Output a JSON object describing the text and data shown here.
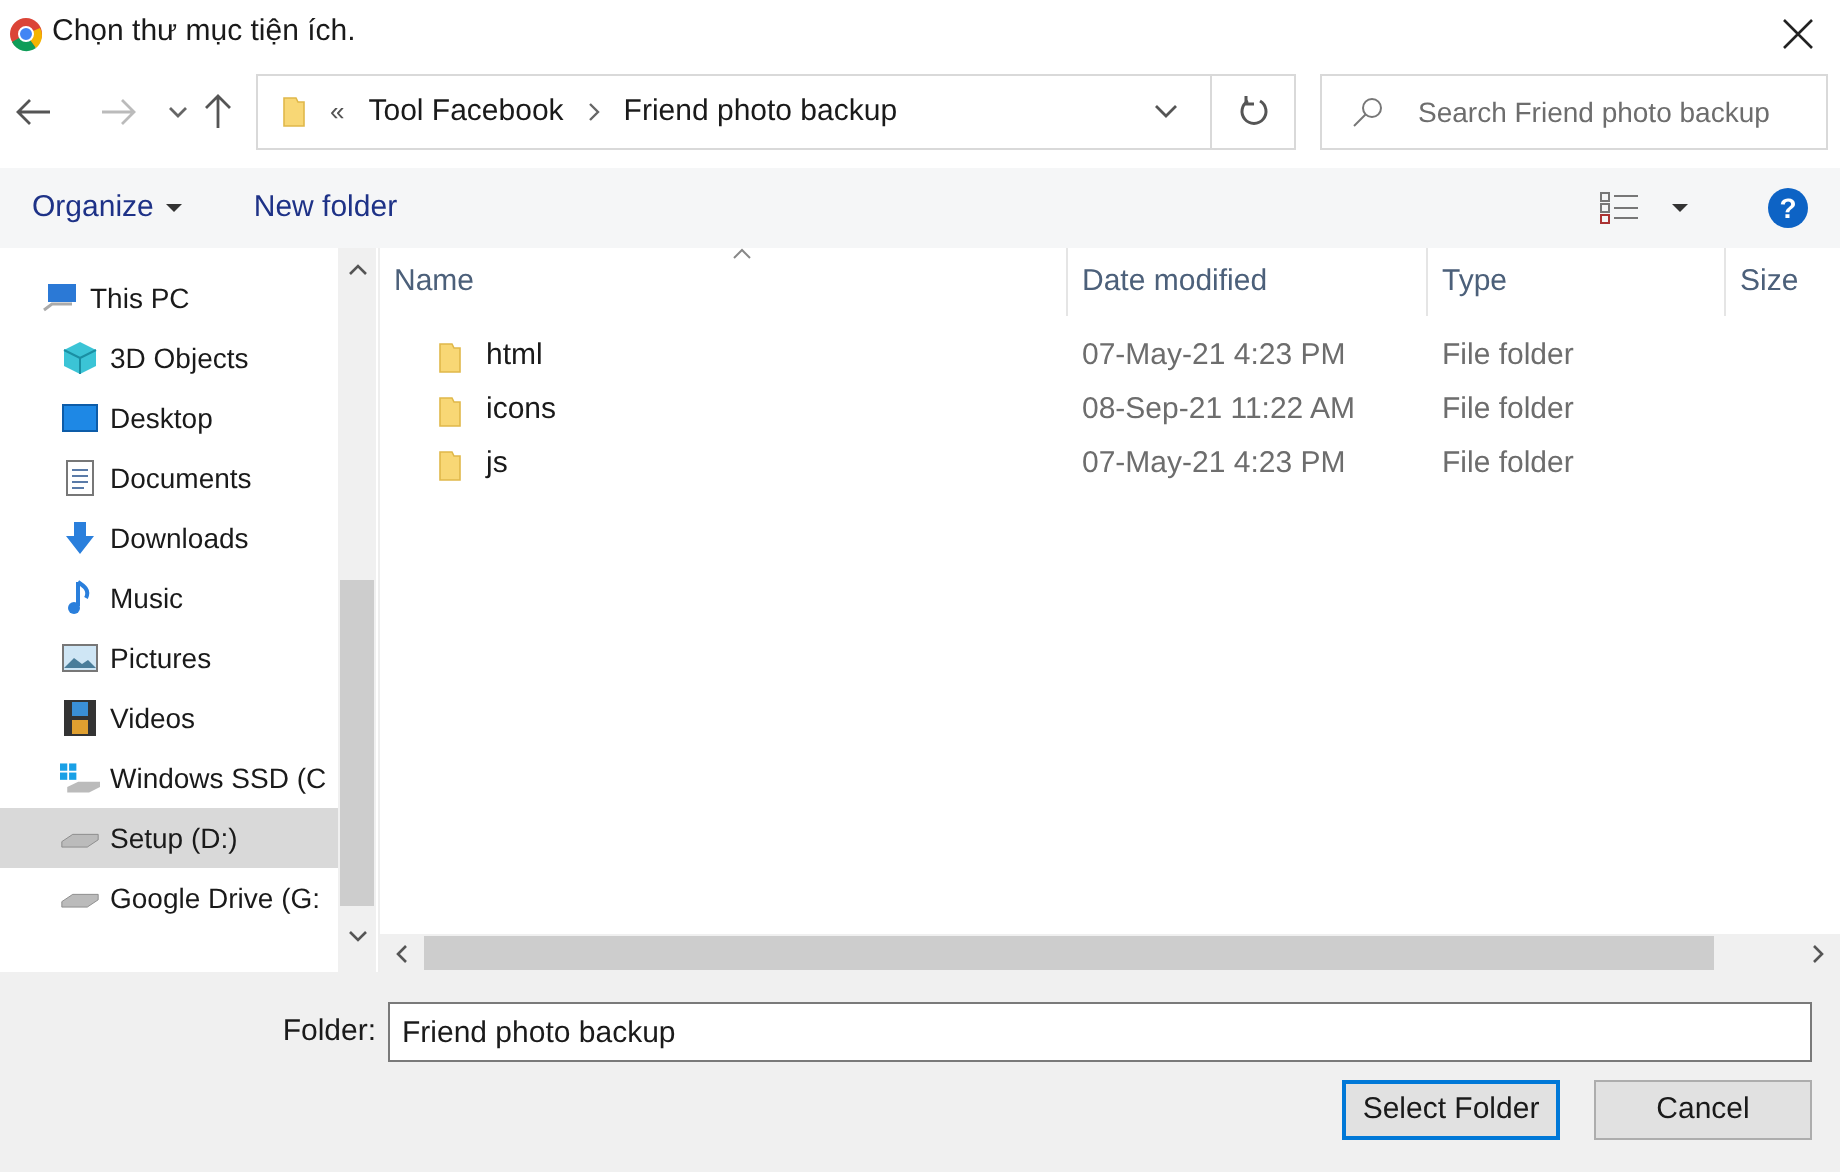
{
  "window": {
    "title": "Chọn thư mục tiện ích."
  },
  "address_bar": {
    "overflow": "«",
    "crumbs": [
      "Tool Facebook",
      "Friend photo backup"
    ]
  },
  "search": {
    "placeholder": "Search Friend photo backup"
  },
  "toolbar": {
    "organize": "Organize",
    "new_folder": "New folder",
    "help": "?"
  },
  "sidebar": {
    "items": [
      {
        "label": "This PC",
        "kind": "pc",
        "selected": false
      },
      {
        "label": "3D Objects",
        "kind": "cube",
        "selected": false
      },
      {
        "label": "Desktop",
        "kind": "desktop",
        "selected": false
      },
      {
        "label": "Documents",
        "kind": "document",
        "selected": false
      },
      {
        "label": "Downloads",
        "kind": "download",
        "selected": false
      },
      {
        "label": "Music",
        "kind": "music",
        "selected": false
      },
      {
        "label": "Pictures",
        "kind": "picture",
        "selected": false
      },
      {
        "label": "Videos",
        "kind": "video",
        "selected": false
      },
      {
        "label": "Windows SSD (C",
        "kind": "windrive",
        "selected": false
      },
      {
        "label": "Setup (D:)",
        "kind": "drive",
        "selected": true
      },
      {
        "label": "Google Drive (G:",
        "kind": "drive",
        "selected": false
      }
    ]
  },
  "table": {
    "columns": [
      "Name",
      "Date modified",
      "Type",
      "Size"
    ],
    "rows": [
      {
        "name": "html",
        "date": "07-May-21 4:23 PM",
        "type": "File folder"
      },
      {
        "name": "icons",
        "date": "08-Sep-21 11:22 AM",
        "type": "File folder"
      },
      {
        "name": "js",
        "date": "07-May-21 4:23 PM",
        "type": "File folder"
      }
    ]
  },
  "footer": {
    "label": "Folder:",
    "value": "Friend photo backup",
    "buttons": [
      "Select Folder",
      "Cancel"
    ]
  }
}
